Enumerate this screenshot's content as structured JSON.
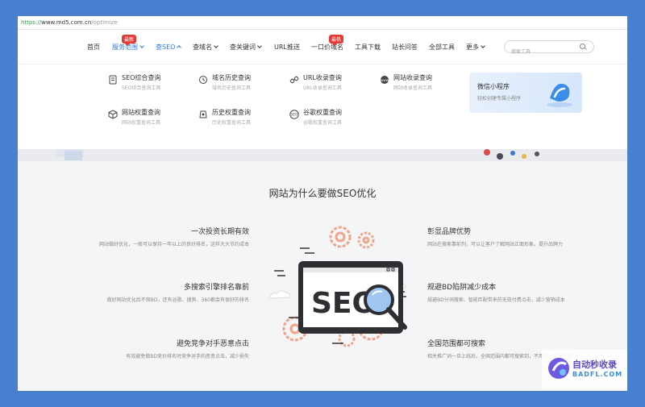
{
  "url": {
    "scheme": "https://",
    "host": "www.md5.com.cn",
    "path": "/optimize"
  },
  "nav": {
    "items": [
      {
        "label": "首页"
      },
      {
        "label": "服务范围",
        "badge": "最新"
      },
      {
        "label": "查SEO"
      },
      {
        "label": "查域名"
      },
      {
        "label": "查关键词"
      },
      {
        "label": "URL推送"
      },
      {
        "label": "一口价域名",
        "badge": "最热"
      },
      {
        "label": "工具下载"
      },
      {
        "label": "站长问答"
      },
      {
        "label": "全部工具"
      },
      {
        "label": "更多"
      }
    ],
    "search_placeholder": "搜索工具"
  },
  "dropdown": {
    "items": [
      {
        "title": "SEO综合查询",
        "sub": "SEO综合查询工具"
      },
      {
        "title": "域名历史查询",
        "sub": "域名历史查询工具"
      },
      {
        "title": "URL收录查询",
        "sub": "URL收录查询工具"
      },
      {
        "title": "网站收录查询",
        "sub": "网站收录查询工具"
      },
      {
        "title": "网站权重查询",
        "sub": "网站权重查询工具"
      },
      {
        "title": "历史权重查询",
        "sub": "历史权重查询工具"
      },
      {
        "title": "谷歌权重查询",
        "sub": "谷歌权重查询工具"
      }
    ],
    "mini": {
      "title": "微信小程序",
      "sub": "轻松创建专属小程序"
    }
  },
  "section": {
    "title": "网站为什么要做SEO优化"
  },
  "features": {
    "left": [
      {
        "title": "一次投资长期有效",
        "desc": "网站做好优化，一般可以保持一年以上的良好排名，这样大大节约成本"
      },
      {
        "title": "多搜索引擎排名靠前",
        "desc": "做好网站优化后不但BD，还有谷歌、搜狗、360都会有很好的排名"
      },
      {
        "title": "避免竞争对手恶意点击",
        "desc": "有效避免做BD竞价排名时竞争对手的恶意点击，减少损失"
      }
    ],
    "right": [
      {
        "title": "彰显品牌优势",
        "desc": "网站在搜索靠前列，可以让客户了解网站正面形象，提升品牌力"
      },
      {
        "title": "规避BD陷阱减少成本",
        "desc": "规避BD分词搜索、智能匹配带来的无效付费点击，减少营销成本"
      },
      {
        "title": "全国范围都可搜索",
        "desc": "相关推广词一旦上线后，全国范围内都可搜索到，不用担心区域问题"
      }
    ]
  },
  "illustration": {
    "word": "SEO"
  },
  "watermark": {
    "text": "自动秒收录",
    "sub": "BADFL.COM"
  },
  "colors": {
    "accent": "#2d7be0",
    "badge": "#e53935",
    "gear": "#f0a58a"
  }
}
